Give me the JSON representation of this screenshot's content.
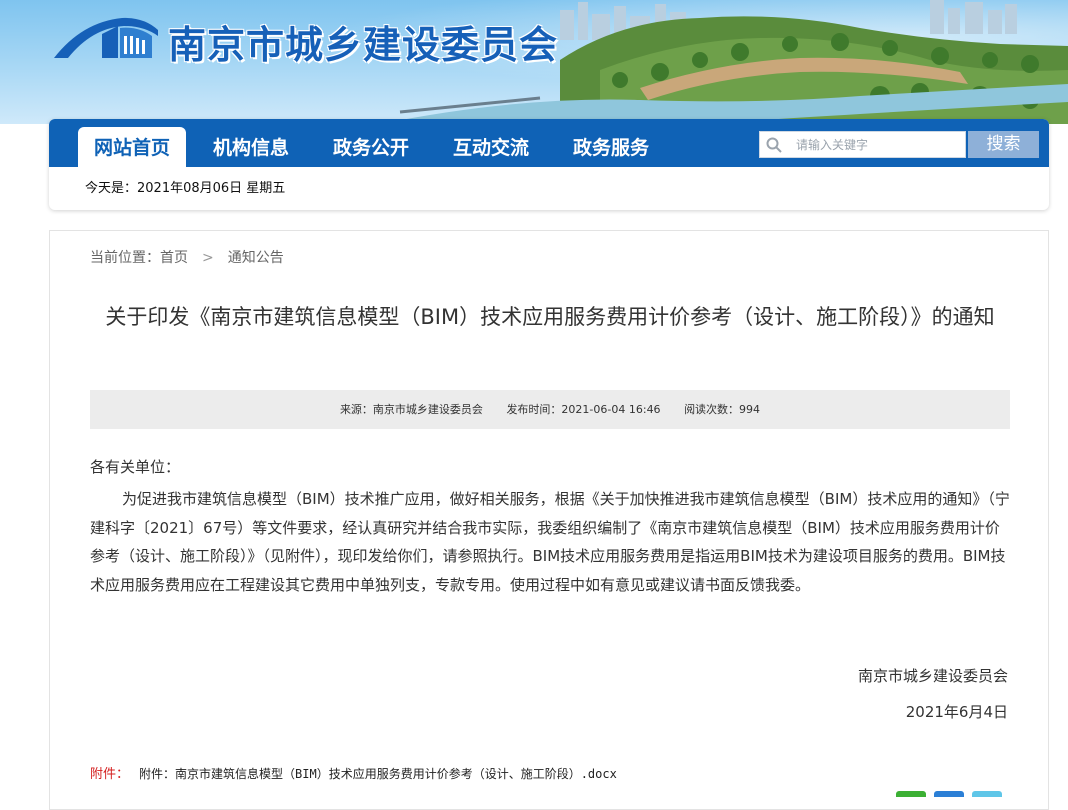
{
  "site": {
    "title": "南京市城乡建设委员会"
  },
  "nav": {
    "items": [
      {
        "label": "网站首页",
        "active": true
      },
      {
        "label": "机构信息",
        "active": false
      },
      {
        "label": "政务公开",
        "active": false
      },
      {
        "label": "互动交流",
        "active": false
      },
      {
        "label": "政务服务",
        "active": false
      }
    ],
    "search_placeholder": "请输入关键字",
    "search_button": "搜索"
  },
  "date_line": "今天是：2021年08月06日 星期五",
  "breadcrumb": {
    "prefix": "当前位置：",
    "home": "首页",
    "separator": ">",
    "current": "通知公告"
  },
  "article": {
    "title": "关于印发《南京市建筑信息模型（BIM）技术应用服务费用计价参考（设计、施工阶段）》的通知",
    "meta": {
      "source": "来源：南京市城乡建设委员会",
      "published": "发布时间：2021-06-04 16:46",
      "views": "阅读次数：994"
    },
    "salutation": "各有关单位：",
    "paragraph": "为促进我市建筑信息模型（BIM）技术推广应用，做好相关服务，根据《关于加快推进我市建筑信息模型（BIM）技术应用的通知》（宁建科字〔2021〕67号）等文件要求，经认真研究并结合我市实际，我委组织编制了《南京市建筑信息模型（BIM）技术应用服务费用计价参考（设计、施工阶段）》（见附件），现印发给你们，请参照执行。BIM技术应用服务费用是指运用BIM技术为建设项目服务的费用。BIM技术应用服务费用应在工程建设其它费用中单独列支，专款专用。使用过程中如有意见或建议请书面反馈我委。",
    "signer": "南京市城乡建设委员会",
    "sign_date": "2021年6月4日",
    "attachment_label": "附件：",
    "attachment_file": "附件：南京市建筑信息模型（BIM）技术应用服务费用计价参考（设计、施工阶段）.docx"
  },
  "colors": {
    "nav_blue": "#0f62b6",
    "title_blue": "#1660b8",
    "attachment_red": "#d42020",
    "search_button": "#8eb0d8"
  }
}
